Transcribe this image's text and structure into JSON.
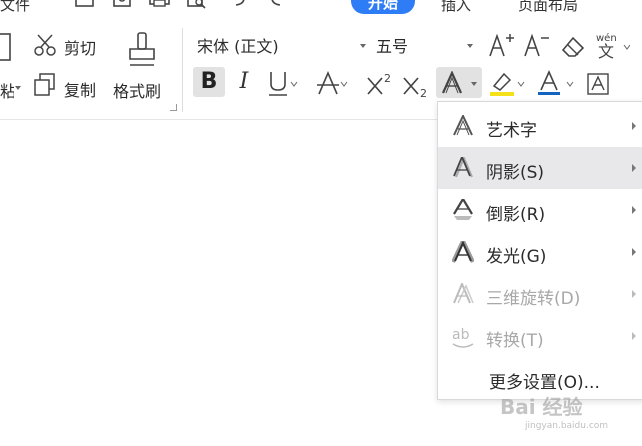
{
  "tabs": {
    "file": "文件",
    "start": "开始",
    "insert": "插入",
    "page_layout": "页面布局"
  },
  "clipboard": {
    "paste": "粘贴",
    "cut": "剪切",
    "copy": "复制",
    "format_painter": "格式刷"
  },
  "font": {
    "family": "宋体 (正文)",
    "size": "五号"
  },
  "text_effects_menu": {
    "items": [
      {
        "label": "艺术字",
        "icon": "art-text-icon",
        "has_submenu": true,
        "disabled": false
      },
      {
        "label": "阴影(S)",
        "icon": "shadow-icon",
        "has_submenu": true,
        "disabled": false,
        "highlighted": true
      },
      {
        "label": "倒影(R)",
        "icon": "reflection-icon",
        "has_submenu": true,
        "disabled": false
      },
      {
        "label": "发光(G)",
        "icon": "glow-icon",
        "has_submenu": true,
        "disabled": false
      },
      {
        "label": "三维旋转(D)",
        "icon": "3d-rotation-icon",
        "has_submenu": true,
        "disabled": true
      },
      {
        "label": "转换(T)",
        "icon": "transform-icon",
        "has_submenu": true,
        "disabled": true
      },
      {
        "label": "更多设置(O)...",
        "icon": "",
        "has_submenu": false,
        "disabled": false
      }
    ]
  },
  "colors": {
    "accent": "#2f7df6",
    "highlight_yellow": "#f5e11a",
    "font_color_blue": "#1565c0",
    "menu_hover": "#e8e8ea"
  },
  "watermark": {
    "text": "Bai 经验",
    "subtext": "jingyan.baidu.com"
  }
}
